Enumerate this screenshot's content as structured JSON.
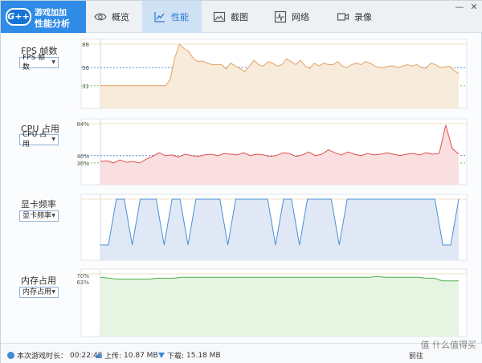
{
  "app": {
    "logo_badge": "G++",
    "logo_line1": "游戏加加",
    "logo_line2": "性能分析",
    "tabs": [
      {
        "label": "概览",
        "icon": "eye-icon"
      },
      {
        "label": "性能",
        "icon": "chart-icon"
      },
      {
        "label": "截图",
        "icon": "image-icon"
      },
      {
        "label": "网络",
        "icon": "pulse-icon"
      },
      {
        "label": "录像",
        "icon": "camera-icon"
      }
    ],
    "active_tab": "性能",
    "window_controls": {
      "minimize": "—",
      "close": "✕"
    }
  },
  "sections": {
    "fps": {
      "label": "FPS 帧数",
      "select": "FPS 帧数"
    },
    "cpu": {
      "label": "CPU 占用",
      "select": "CPU 占用"
    },
    "gpu": {
      "label": "显卡频率",
      "select": "显卡频率"
    },
    "mem": {
      "label": "内存占用",
      "select": "内存占用"
    }
  },
  "footer": {
    "duration_label": "本次游戏时长：",
    "duration_value": "00:22:43",
    "upload_label": "上传:",
    "upload_value": "10.87 MB",
    "download_label": "下载:",
    "download_value": "15.18 MB",
    "right_text": "前往",
    "watermark": "值 什么值得买"
  },
  "colors": {
    "accent": "#2f8be6",
    "fps_line": "#e8a060",
    "fps_fill": "#f7ebdb",
    "cpu_line": "#e05050",
    "cpu_fill": "#f9dfdf",
    "gpu_line": "#4a90d9",
    "gpu_fill": "#dfe8f4",
    "mem_line": "#4cae4c",
    "mem_fill": "#e6f4e2"
  },
  "chart_data": [
    {
      "type": "area",
      "name": "fps",
      "y_ticks": [
        "88",
        "56",
        "31"
      ],
      "y_tick_values": [
        88,
        56,
        31
      ],
      "ylim": [
        0,
        88
      ],
      "ref_lines": {
        "blue": 56,
        "green": 31
      },
      "values": [
        31,
        31,
        31,
        31,
        31,
        31,
        31,
        31,
        31,
        31,
        31,
        31,
        31,
        31,
        31,
        40,
        70,
        88,
        82,
        78,
        68,
        64,
        65,
        62,
        60,
        60,
        60,
        54,
        62,
        58,
        55,
        50,
        58,
        66,
        60,
        58,
        64,
        62,
        58,
        60,
        68,
        64,
        60,
        66,
        58,
        55,
        62,
        58,
        62,
        60,
        60,
        64,
        58,
        56,
        60,
        62,
        60,
        64,
        62,
        58,
        56,
        56,
        58,
        58,
        56,
        58,
        60,
        58,
        60,
        56,
        55,
        62,
        60,
        56,
        57,
        58,
        52,
        48
      ]
    },
    {
      "type": "area",
      "name": "cpu",
      "y_ticks": [
        "84%",
        "40%",
        "30%"
      ],
      "y_tick_values": [
        84,
        40,
        30
      ],
      "ylim": [
        0,
        84
      ],
      "ref_lines": {
        "blue": 40,
        "green": 30
      },
      "values": [
        32,
        33,
        30,
        34,
        31,
        32,
        30,
        35,
        39,
        44,
        40,
        41,
        38,
        42,
        40,
        39,
        41,
        42,
        40,
        43,
        42,
        41,
        44,
        40,
        42,
        41,
        39,
        40,
        44,
        43,
        39,
        41,
        45,
        40,
        42,
        48,
        44,
        41,
        45,
        42,
        40,
        43,
        41,
        42,
        44,
        42,
        40,
        42,
        43,
        41,
        44,
        42,
        43,
        82,
        50,
        42
      ]
    },
    {
      "type": "area",
      "name": "gpu",
      "ylim": [
        0,
        1
      ],
      "values": [
        0.25,
        0.25,
        1,
        1,
        0.25,
        1,
        1,
        1,
        0.25,
        1,
        1,
        0.25,
        1,
        1,
        1,
        1,
        0.25,
        1,
        1,
        1,
        1,
        1,
        0.25,
        1,
        1,
        0.25,
        1,
        1,
        1,
        1,
        0.25,
        1,
        1,
        1,
        1,
        1,
        1,
        1,
        1,
        1,
        1,
        1,
        1,
        0.25,
        0.25,
        1
      ]
    },
    {
      "type": "area",
      "name": "mem",
      "y_ticks": [
        "70%",
        "63%"
      ],
      "y_tick_values": [
        70,
        63
      ],
      "ylim": [
        0,
        72
      ],
      "values": [
        68,
        67,
        66,
        66,
        66,
        66,
        66,
        67,
        67,
        67,
        68,
        68,
        68,
        68,
        68,
        68,
        68,
        68,
        68,
        68,
        68,
        68,
        68,
        68,
        68,
        68,
        68,
        68,
        68,
        68,
        68,
        68,
        68,
        68,
        69,
        68,
        68,
        68,
        68,
        68,
        67,
        67,
        64,
        64,
        64
      ]
    }
  ]
}
